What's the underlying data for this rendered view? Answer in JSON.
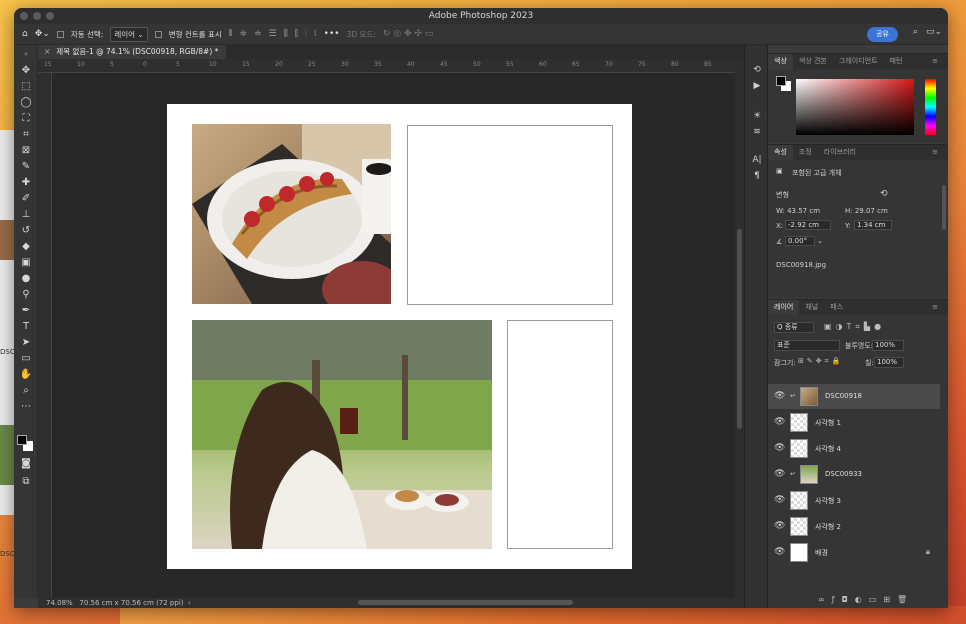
{
  "window": {
    "title": "Adobe Photoshop 2023"
  },
  "options_bar": {
    "auto_select_label": "자동 선택:",
    "layer_select": "레이어",
    "transform_controls_label": "변형 컨트롤 표시",
    "mode_3d_label": "3D 모드:",
    "share_button": "공유"
  },
  "document_tab": {
    "close": "×",
    "title": "제목 없음-1 @ 74.1% (DSC00918, RGB/8#) *"
  },
  "ruler_ticks": [
    "15",
    "10",
    "5",
    "0",
    "5",
    "10",
    "15",
    "20",
    "25",
    "30",
    "35",
    "40",
    "45",
    "50",
    "55",
    "60",
    "65",
    "70",
    "75",
    "80",
    "85"
  ],
  "status": {
    "zoom": "74.08%",
    "doc_size": "70.56 cm x 70.56 cm (72 ppi)",
    "arrow": "›"
  },
  "desktop": {
    "labels": [
      "DSC",
      "DSC"
    ]
  },
  "color_panel": {
    "tabs": [
      "색상",
      "색상 견본",
      "그레이디언트",
      "패턴"
    ],
    "foreground": "#000000",
    "background": "#ffffff"
  },
  "properties_panel": {
    "tabs": [
      "속성",
      "조정",
      "라이브러리"
    ],
    "object_type": "포함된 고급 개체",
    "transform_label": "변형",
    "w": "W: 43.57 cm",
    "h": "H: 29.07 cm",
    "x_label": "X:",
    "x": "-2.92 cm",
    "y_label": "Y:",
    "y": "1.34 cm",
    "angle": "0.00°",
    "filename": "DSC00918.jpg"
  },
  "layers_panel": {
    "tabs": [
      "레이어",
      "채널",
      "패스"
    ],
    "filter": "Q 종류",
    "blend_mode": "표준",
    "opacity_label": "불투명도:",
    "opacity": "100%",
    "lock_label": "잠그기:",
    "fill_label": "칠:",
    "fill": "100%",
    "layers": [
      {
        "name": "DSC00918",
        "type": "photo",
        "selected": true,
        "linked": true
      },
      {
        "name": "사각형 1",
        "type": "shape",
        "selected": false,
        "linked": false
      },
      {
        "name": "사각형 4",
        "type": "shape",
        "selected": false,
        "linked": false
      },
      {
        "name": "DSC00933",
        "type": "photo",
        "selected": false,
        "linked": true
      },
      {
        "name": "사각형 3",
        "type": "shape",
        "selected": false,
        "linked": false
      },
      {
        "name": "사각형 2",
        "type": "shape",
        "selected": false,
        "linked": false
      },
      {
        "name": "배경",
        "type": "background",
        "selected": false,
        "linked": false
      }
    ]
  },
  "colors": {
    "accent": "#3c73d6",
    "selected_layer": "#4a4a4a"
  }
}
